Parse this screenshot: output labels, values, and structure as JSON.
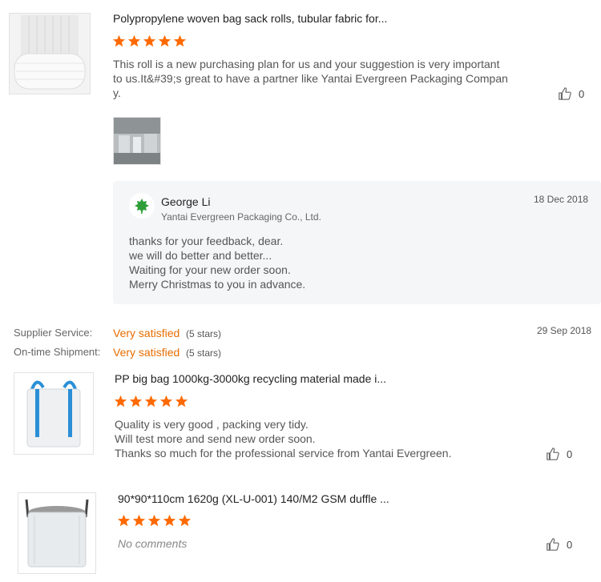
{
  "review1": {
    "product_title": "Polypropylene woven bag sack rolls, tubular fabric for...",
    "rating": 5,
    "text_lines": [
      "This roll is a new purchasing plan for us and your suggestion is very important",
      "to us.It&#39;s great to have a partner like Yantai Evergreen Packaging Compan",
      "y."
    ],
    "likes": "0",
    "reply": {
      "name": "George Li",
      "company": "Yantai Evergreen Packaging Co., Ltd.",
      "date": "18 Dec 2018",
      "lines": [
        "thanks for your feedback, dear.",
        "we will do better and better...",
        "Waiting for your new order soon.",
        "Merry Christmas to you in advance."
      ]
    }
  },
  "feedback": {
    "supplier_service_label": "Supplier Service:",
    "supplier_service_value": "Very satisfied",
    "supplier_service_stars": "(5 stars)",
    "ontime_label": "On-time Shipment:",
    "ontime_value": "Very satisfied",
    "ontime_stars": "(5 stars)",
    "date": "29 Sep 2018"
  },
  "review2": {
    "product_title": "PP big bag 1000kg-3000kg recycling material made i...",
    "rating": 5,
    "text_lines": [
      "Quality is very good , packing very tidy.",
      "Will test more and send new order soon.",
      "Thanks so much for the professional service from Yantai Evergreen."
    ],
    "likes": "0"
  },
  "review3": {
    "product_title": "90*90*110cm 1620g (XL-U-001) 140/M2 GSM duffle ...",
    "rating": 5,
    "no_comments": "No comments",
    "likes": "0"
  },
  "colors": {
    "star": "#ff6a00",
    "accent": "#e86d00",
    "reply_bg": "#f4f6f8"
  },
  "icons": {
    "star": "star-icon",
    "like": "thumbs-up-icon",
    "avatar": "leaf-logo-icon"
  }
}
